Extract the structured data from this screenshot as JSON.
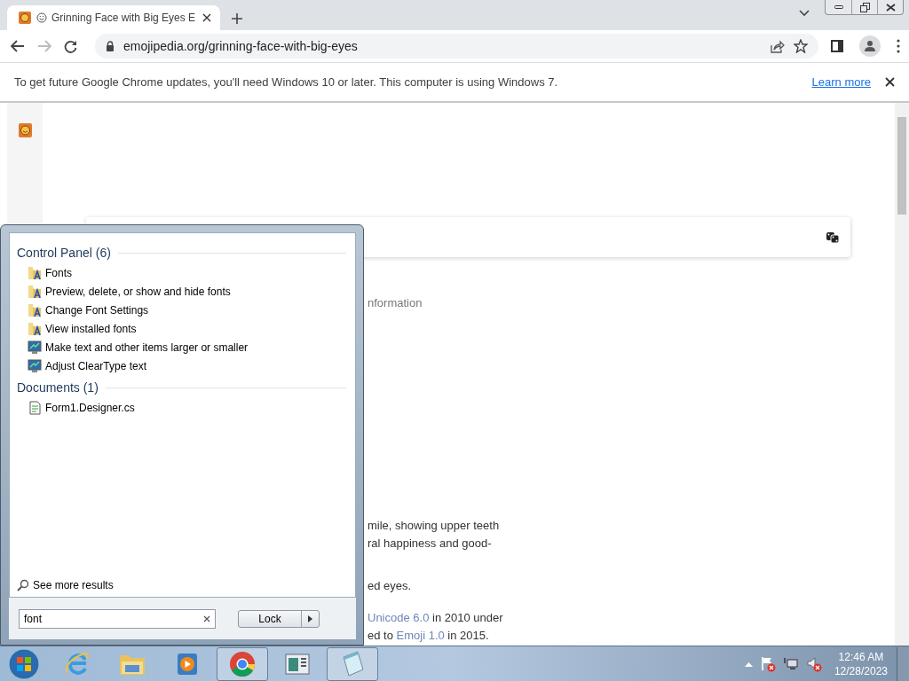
{
  "browser": {
    "tabs": [
      {
        "title": "Grinning Face with Big Eyes E",
        "selected": true
      }
    ],
    "navigation": {
      "back_enabled": true,
      "forward_enabled": false
    },
    "address": "emojipedia.org/grinning-face-with-big-eyes",
    "infobar": {
      "message": "To get future Google Chrome updates, you'll need Windows 10 or later. This computer is using Windows 7.",
      "link": "Learn more"
    }
  },
  "page": {
    "nav_text": "nformation",
    "paragraphs": [
      {
        "lines": [
          {
            "kind": "text",
            "text": "mile, showing upper teeth"
          },
          {
            "kind": "text",
            "text": "ral happiness and good-"
          }
        ]
      },
      {
        "lines": [
          {
            "kind": "text",
            "text": "ed eyes."
          }
        ]
      },
      {
        "lines": [
          {
            "kind": "link",
            "link": "Unicode 6.0",
            "after": " in 2010 under"
          },
          {
            "kind": "link",
            "before": "ed to ",
            "link": "Emoji 1.0",
            "after": " in 2015."
          }
        ]
      }
    ]
  },
  "start_menu": {
    "groups": [
      {
        "title": "Control Panel (6)",
        "items": [
          {
            "label": "Fonts",
            "kind": "fonts"
          },
          {
            "label": "Preview, delete, or show and hide fonts",
            "kind": "fonts"
          },
          {
            "label": "Change Font Settings",
            "kind": "fonts"
          },
          {
            "label": "View installed fonts",
            "kind": "fonts"
          },
          {
            "label": "Make text and other items larger or smaller",
            "kind": "display"
          },
          {
            "label": "Adjust ClearType text",
            "kind": "display"
          }
        ]
      },
      {
        "title": "Documents (1)",
        "items": [
          {
            "label": "Form1.Designer.cs",
            "kind": "code"
          }
        ]
      }
    ],
    "see_more": "See more results",
    "search": {
      "value": "font"
    },
    "lock_button": "Lock"
  },
  "taskbar": {
    "apps": [
      {
        "kind": "ie",
        "running": false
      },
      {
        "kind": "explorer",
        "running": false
      },
      {
        "kind": "media",
        "running": false
      },
      {
        "kind": "chrome",
        "running": true
      },
      {
        "kind": "app",
        "running": false
      },
      {
        "kind": "notepad",
        "running": true
      }
    ],
    "tray": [
      {
        "kind": "flag",
        "error": true
      },
      {
        "kind": "network",
        "error": false
      },
      {
        "kind": "speaker",
        "error": true
      }
    ],
    "time": "12:46 AM",
    "date": "12/28/2023"
  }
}
